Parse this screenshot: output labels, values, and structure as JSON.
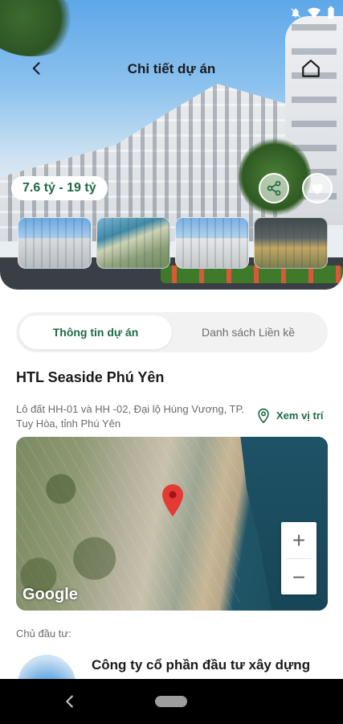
{
  "header": {
    "title": "Chi tiết dự án"
  },
  "hero": {
    "price_range": "7.6 tỷ  - 19 tỷ",
    "thumbnail_count": 4
  },
  "tabs": [
    {
      "label": "Thông tin dự án",
      "active": true
    },
    {
      "label": "Danh sách Liền kề",
      "active": false
    }
  ],
  "project": {
    "name": "HTL Seaside Phú Yên",
    "address": "Lô đất HH-01 và HH -02, Đại lộ Hùng Vương, TP. Tuy Hòa, tỉnh Phú Yên",
    "view_location_label": "Xem vị trí"
  },
  "map": {
    "attribution": "Google",
    "zoom_in": "+",
    "zoom_out": "−"
  },
  "investor": {
    "label": "Chủ đầu tư:",
    "name": "Công ty cổ phần đầu tư xây dựng"
  },
  "colors": {
    "accent_green": "#1e6b45",
    "tab_bg": "#f1f2f1",
    "muted_text": "#6b6b6b",
    "pin_red": "#e53935"
  },
  "icons": {
    "back": "back-arrow-icon",
    "home": "home-icon",
    "share": "share-icon",
    "favorite": "heart-icon",
    "location": "location-pin-icon",
    "map_marker": "map-marker-icon"
  }
}
